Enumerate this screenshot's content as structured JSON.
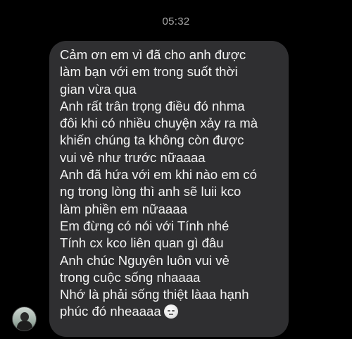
{
  "conversation": {
    "timestamp": "05:32",
    "message": {
      "lines": [
        "Cảm ơn em vì đã cho anh được",
        "làm bạn với em trong suốt thời",
        "gian vừa qua",
        "Anh rất trân trọng điều đó nhma",
        "đôi khi có nhiều chuyện xảy ra mà",
        "khiến chúng ta không còn được",
        "vui vẻ như trước nữaaaa",
        "Anh đã hứa với em khi nào em có",
        "ng trong lòng thì anh sẽ luii kco",
        "làm phiền em nữaaaa",
        "Em đừng có nói với Tính nhé",
        "Tính cx kco liên quan gì đâu",
        "Anh chúc Nguyên luôn vui vẻ",
        "trong cuộc sống nhaaaa",
        "Nhớ là phải sống thiệt làaa hạnh",
        "phúc đó nheaaaa"
      ],
      "trailing_emoji": "neutral-face-emoji"
    },
    "sender_avatar": "avatar-photo"
  },
  "colors": {
    "background": "#000000",
    "bubble": "#2f2f31",
    "text": "#f2f2f2",
    "timestamp": "#a9a9a9"
  }
}
